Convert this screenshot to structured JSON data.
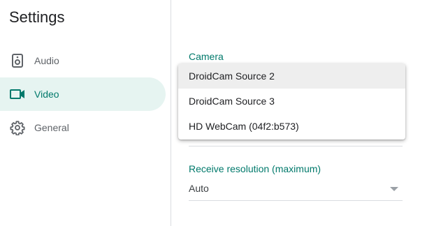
{
  "sidebar": {
    "title": "Settings",
    "items": [
      {
        "label": "Audio",
        "icon": "speaker-icon"
      },
      {
        "label": "Video",
        "icon": "videocam-icon",
        "active": true
      },
      {
        "label": "General",
        "icon": "gear-icon"
      }
    ]
  },
  "main": {
    "camera": {
      "label": "Camera",
      "options": [
        "DroidCam Source 2",
        "DroidCam Source 3",
        "HD WebCam (04f2:b573)"
      ],
      "highlighted_option": "DroidCam Source 2"
    },
    "receive_resolution": {
      "label": "Receive resolution (maximum)",
      "value": "Auto"
    }
  },
  "colors": {
    "accent": "#00796b",
    "active_bg": "#e6f4f1",
    "divider": "#dadce0",
    "menu_highlight": "#eeeeee"
  }
}
